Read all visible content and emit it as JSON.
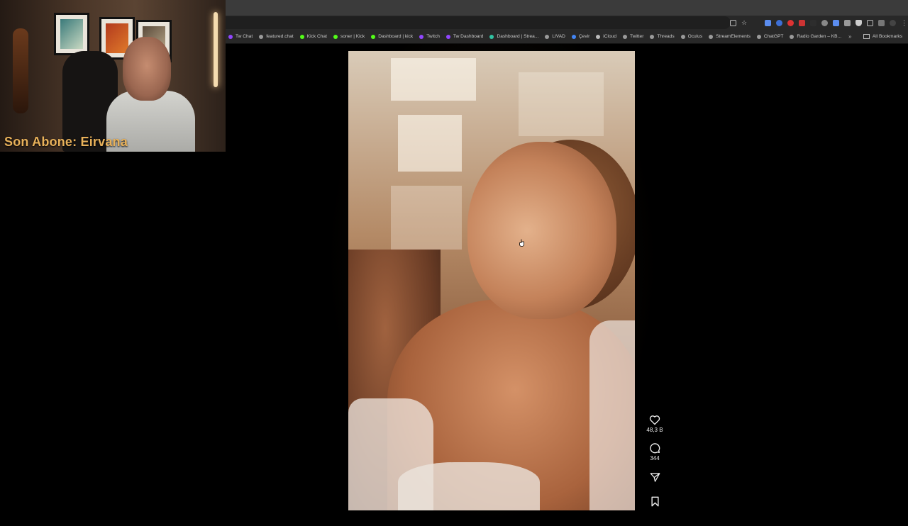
{
  "webcam": {
    "subscriber_label": "Son Abone: Eirvana"
  },
  "browser": {
    "bookmarks": [
      {
        "label": "Tw Chat",
        "icon": "twitch-icon",
        "color": "#9146ff"
      },
      {
        "label": "featured.chat",
        "icon": "globe-icon",
        "color": "#9a9a9a"
      },
      {
        "label": "Kick Chat",
        "icon": "kick-icon",
        "color": "#53fc18"
      },
      {
        "label": "soner | Kick",
        "icon": "kick-icon",
        "color": "#53fc18"
      },
      {
        "label": "Dashboard | kick",
        "icon": "kick-icon",
        "color": "#53fc18"
      },
      {
        "label": "Twitch",
        "icon": "twitch-icon",
        "color": "#9146ff"
      },
      {
        "label": "Tw Dashboard",
        "icon": "twitch-icon",
        "color": "#9146ff"
      },
      {
        "label": "Dashboard | Strea...",
        "icon": "streamlabs-icon",
        "color": "#31c3a2"
      },
      {
        "label": "LIVAD",
        "icon": "globe-icon",
        "color": "#9a9a9a"
      },
      {
        "label": "Çevir",
        "icon": "translate-icon",
        "color": "#4285f4"
      },
      {
        "label": "iCloud",
        "icon": "apple-icon",
        "color": "#bbbbbb"
      },
      {
        "label": "Twitter",
        "icon": "globe-icon",
        "color": "#9a9a9a"
      },
      {
        "label": "Threads",
        "icon": "globe-icon",
        "color": "#9a9a9a"
      },
      {
        "label": "Oculus",
        "icon": "globe-icon",
        "color": "#9a9a9a"
      },
      {
        "label": "StreamElements",
        "icon": "globe-icon",
        "color": "#9a9a9a"
      },
      {
        "label": "ChatGPT",
        "icon": "globe-icon",
        "color": "#9a9a9a"
      },
      {
        "label": "Radio Garden – KB...",
        "icon": "globe-icon",
        "color": "#9a9a9a"
      }
    ],
    "all_bookmarks_label": "All Bookmarks",
    "overflow_label": "»"
  },
  "reel": {
    "likes": "48,3 B",
    "comments": "344"
  }
}
